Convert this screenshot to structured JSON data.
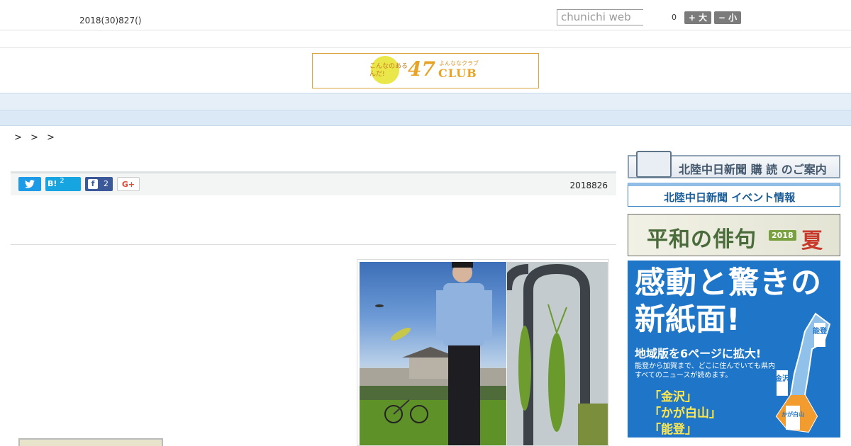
{
  "header": {
    "date": "2018(30)827()",
    "search_placeholder": "chunichi web",
    "zoom_value": "0",
    "font_larger": "+ 大",
    "font_smaller": "− 小"
  },
  "banner": {
    "tagline": "こんなのあるんだ!",
    "number": "47",
    "kana": "よんななクラブ",
    "club": "CLUB"
  },
  "nav": {
    "items": [
      "",
      "",
      "",
      "",
      "",
      "",
      "",
      "",
      ""
    ]
  },
  "breadcrumb": "> > >",
  "article": {
    "share": {
      "hatena_label": "B!",
      "hatena_count": "2",
      "facebook_count": "2",
      "gplus_label": "G+"
    },
    "pub_date": "2018826"
  },
  "sidebar": {
    "ad_subscription": "北陸中日新聞 購 読 のご案内",
    "ad_events": "北陸中日新聞 イベント情報",
    "ad_haiku": {
      "title": "平和の俳句",
      "year": "2018",
      "season": "夏"
    },
    "ad_newspaper": {
      "line1": "感動と驚きの",
      "line2": "新紙面!",
      "line3": "地域版を6ページに拡大!",
      "line4": "能登から加賀まで、どこに住んでいても県内すべてのニュースが読めます。",
      "editions": [
        "「金沢」",
        "「かが白山」",
        "「能登」"
      ],
      "map_labels": [
        "能登",
        "金沢",
        "かが白山"
      ]
    }
  }
}
